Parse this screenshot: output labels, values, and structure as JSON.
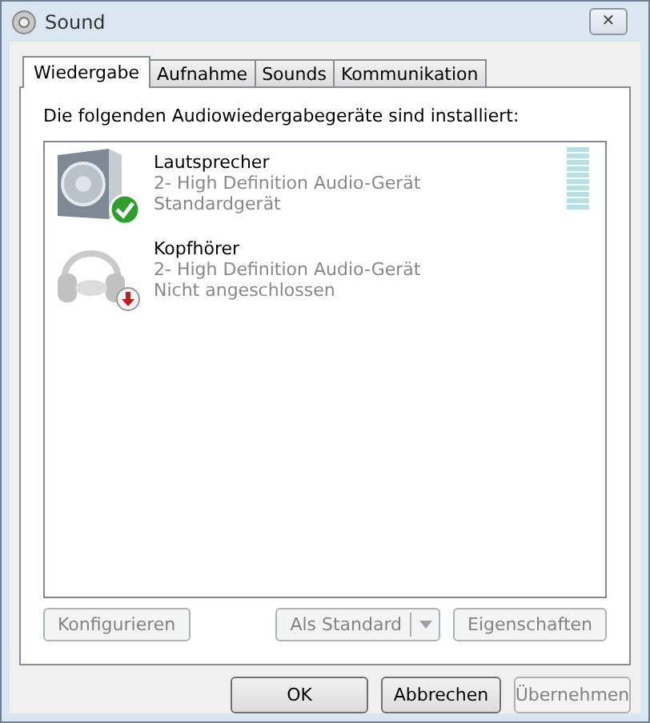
{
  "window": {
    "title": "Sound",
    "close": "✕"
  },
  "tabs": [
    {
      "label": "Wiedergabe",
      "selected": true
    },
    {
      "label": "Aufnahme",
      "selected": false
    },
    {
      "label": "Sounds",
      "selected": false
    },
    {
      "label": "Kommunikation",
      "selected": false
    }
  ],
  "heading": "Die folgenden Audiowiedergabegeräte sind installiert:",
  "devices": [
    {
      "kind": "speaker",
      "default": true,
      "connected": true,
      "name": "Lautsprecher",
      "description": "2- High Definition Audio-Gerät",
      "status": "Standardgerät",
      "level": 0
    },
    {
      "kind": "headphones",
      "default": false,
      "connected": false,
      "name": "Kopfhörer",
      "description": "2- High Definition Audio-Gerät",
      "status": "Nicht angeschlossen"
    }
  ],
  "panel_buttons": [
    {
      "label": "Konfigurieren",
      "disabled": true,
      "kind": "plain"
    },
    {
      "label": "Als Standard",
      "disabled": true,
      "kind": "split"
    },
    {
      "label": "Eigenschaften",
      "disabled": true,
      "kind": "plain"
    }
  ],
  "dialog_buttons": [
    {
      "label": "OK",
      "disabled": false
    },
    {
      "label": "Abbrechen",
      "disabled": false
    },
    {
      "label": "Übernehmen",
      "disabled": true
    }
  ]
}
